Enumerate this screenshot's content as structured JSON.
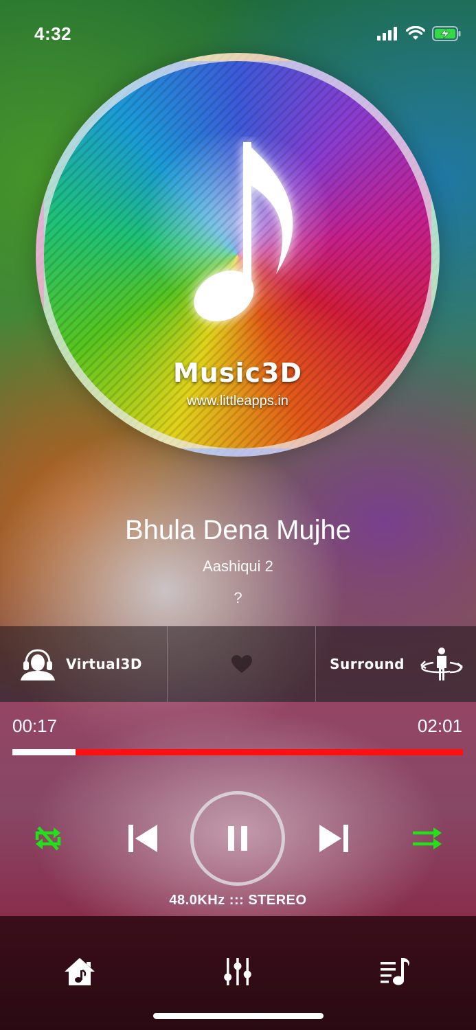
{
  "status_bar": {
    "time": "4:32",
    "icons": [
      "cellular-signal-icon",
      "wifi-icon",
      "battery-charging-icon"
    ]
  },
  "album_art": {
    "brand": "Music3D",
    "url": "www.littleapps.in",
    "icon": "music-note-icon"
  },
  "track": {
    "title": "Bhula Dena Mujhe",
    "album": "Aashiqui 2",
    "artist": "?"
  },
  "effects": {
    "virtual3d_label": "Virtual3D",
    "surround_label": "Surround",
    "icons": [
      "headphones-person-icon",
      "heart-icon",
      "surround-person-icon"
    ]
  },
  "progress": {
    "current": "00:17",
    "total": "02:01",
    "fraction": 0.14
  },
  "controls": {
    "audio_info": "48.0KHz ::: STEREO",
    "icons": [
      "repeat-off-icon",
      "previous-track-icon",
      "pause-icon",
      "next-track-icon",
      "shuffle-icon"
    ]
  },
  "tab_bar": {
    "icons": [
      "home-music-icon",
      "equalizer-icon",
      "playlist-icon"
    ]
  },
  "colors": {
    "progress_played": "#ffffff",
    "progress_remaining": "#ff1010",
    "accent_green": "#22e01a"
  }
}
